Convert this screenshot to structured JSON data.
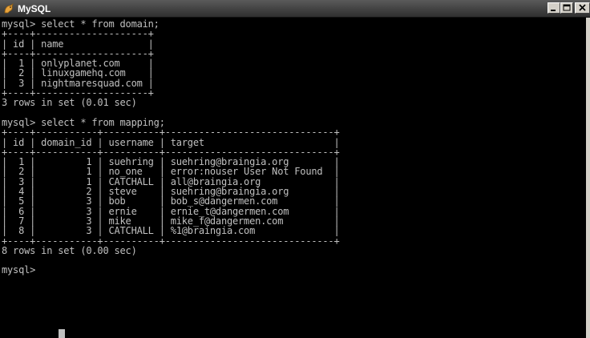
{
  "window": {
    "title": "MySQL",
    "icon": "mysql-dolphin-icon",
    "controls": [
      "minimize-icon",
      "maximize-icon",
      "close-icon"
    ]
  },
  "console": {
    "lines": [
      "mysql> select * from domain;",
      "+----+--------------------+",
      "| id | name               |",
      "+----+--------------------+",
      "|  1 | onlyplanet.com     |",
      "|  2 | linuxgamehq.com    |",
      "|  3 | nightmaresquad.com |",
      "+----+--------------------+",
      "3 rows in set (0.01 sec)",
      "",
      "mysql> select * from mapping;",
      "+----+-----------+----------+------------------------------+",
      "| id | domain_id | username | target                       |",
      "+----+-----------+----------+------------------------------+",
      "|  1 |         1 | suehring | suehring@braingia.org        |",
      "|  2 |         1 | no_one   | error:nouser User Not Found  |",
      "|  3 |         1 | CATCHALL | all@braingia.org             |",
      "|  4 |         2 | steve    | suehring@braingia.org        |",
      "|  5 |         3 | bob      | bob_s@dangermen.com          |",
      "|  6 |         3 | ernie    | ernie_t@dangermen.com        |",
      "|  7 |         3 | mike     | mike_f@dangermen.com         |",
      "|  8 |         3 | CATCHALL | %1@braingia.com              |",
      "+----+-----------+----------+------------------------------+",
      "8 rows in set (0.00 sec)",
      "",
      "mysql> "
    ],
    "text_color": "#c0c0c0",
    "background_color": "#000000"
  }
}
